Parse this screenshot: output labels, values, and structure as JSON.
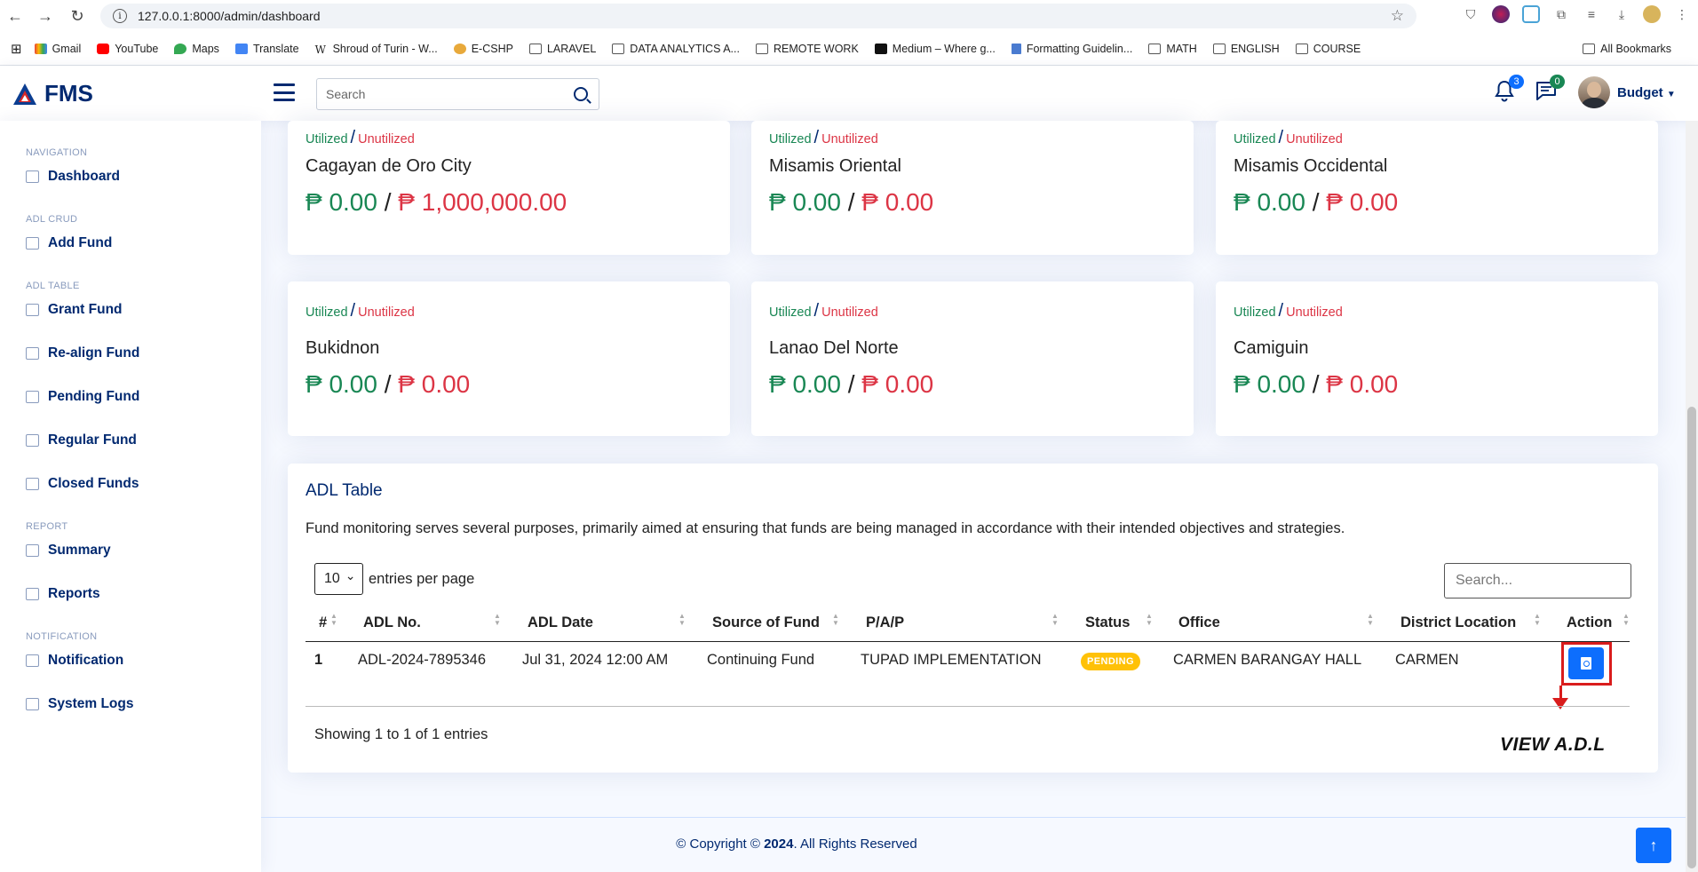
{
  "browser": {
    "url": "127.0.0.1:8000/admin/dashboard",
    "bookmarks": [
      {
        "label": "Gmail",
        "icon": "gmail-icon"
      },
      {
        "label": "YouTube",
        "icon": "youtube-icon"
      },
      {
        "label": "Maps",
        "icon": "maps-icon"
      },
      {
        "label": "Translate",
        "icon": "translate-icon"
      },
      {
        "label": "Shroud of Turin - W...",
        "icon": "wikipedia-icon"
      },
      {
        "label": "E-CSHP",
        "icon": "site-icon"
      },
      {
        "label": "LARAVEL",
        "icon": "folder-icon"
      },
      {
        "label": "DATA ANALYTICS A...",
        "icon": "folder-icon"
      },
      {
        "label": "REMOTE WORK",
        "icon": "folder-icon"
      },
      {
        "label": "Medium – Where g...",
        "icon": "medium-icon"
      },
      {
        "label": "Formatting Guidelin...",
        "icon": "doc-icon"
      },
      {
        "label": "MATH",
        "icon": "folder-icon"
      },
      {
        "label": "ENGLISH",
        "icon": "folder-icon"
      },
      {
        "label": "COURSE",
        "icon": "folder-icon"
      }
    ],
    "all_bookmarks": "All Bookmarks"
  },
  "header": {
    "logo": "FMS",
    "search_placeholder": "Search",
    "notifications_count": "3",
    "messages_count": "0",
    "user_name": "Budget"
  },
  "sidebar": {
    "sections": [
      {
        "heading": "NAVIGATION",
        "items": [
          {
            "label": "Dashboard",
            "icon": "grid-icon"
          }
        ]
      },
      {
        "heading": "ADL CRUD",
        "items": [
          {
            "label": "Add Fund",
            "icon": "card-icon"
          }
        ]
      },
      {
        "heading": "ADL TABLE",
        "items": [
          {
            "label": "Grant Fund",
            "icon": "calendar-icon"
          },
          {
            "label": "Re-align Fund",
            "icon": "document-icon"
          },
          {
            "label": "Pending Fund",
            "icon": "calendar-icon"
          },
          {
            "label": "Regular Fund",
            "icon": "id-card-icon"
          },
          {
            "label": "Closed Funds",
            "icon": "receipt-icon"
          }
        ]
      },
      {
        "heading": "REPORT",
        "items": [
          {
            "label": "Summary",
            "icon": "bar-chart-icon"
          },
          {
            "label": "Reports",
            "icon": "line-chart-icon"
          }
        ]
      },
      {
        "heading": "NOTIFICATION",
        "items": [
          {
            "label": "Notification",
            "icon": "bell-icon"
          },
          {
            "label": "System Logs",
            "icon": "gear-icon"
          }
        ]
      }
    ]
  },
  "regions": [
    {
      "name": "Cagayan de Oro City",
      "utilized": "₱ 0.00",
      "unutilized": "₱ 1,000,000.00"
    },
    {
      "name": "Misamis Oriental",
      "utilized": "₱ 0.00",
      "unutilized": "₱ 0.00"
    },
    {
      "name": "Misamis Occidental",
      "utilized": "₱ 0.00",
      "unutilized": "₱ 0.00"
    },
    {
      "name": "Bukidnon",
      "utilized": "₱ 0.00",
      "unutilized": "₱ 0.00"
    },
    {
      "name": "Lanao Del Norte",
      "utilized": "₱ 0.00",
      "unutilized": "₱ 0.00"
    },
    {
      "name": "Camiguin",
      "utilized": "₱ 0.00",
      "unutilized": "₱ 0.00"
    }
  ],
  "labels": {
    "utilized": "Utilized",
    "unutilized": "Unutilized",
    "separator": "/"
  },
  "adl_table": {
    "title": "ADL Table",
    "description": "Fund monitoring serves several purposes, primarily aimed at ensuring that funds are being managed in accordance with their intended objectives and strategies.",
    "page_size": "10",
    "entries_label": "entries per page",
    "search_placeholder": "Search...",
    "columns": [
      "#",
      "ADL No.",
      "ADL Date",
      "Source of Fund",
      "P/A/P",
      "Status",
      "Office",
      "District Location",
      "Action"
    ],
    "rows": [
      {
        "num": "1",
        "adl_no": "ADL-2024-7895346",
        "adl_date": "Jul 31, 2024 12:00 AM",
        "source": "Continuing Fund",
        "pap": "TUPAD IMPLEMENTATION",
        "status": "PENDING",
        "office": "CARMEN BARANGAY HALL",
        "district": "CARMEN"
      }
    ],
    "showing": "Showing 1 to 1 of 1 entries",
    "annotation": "VIEW A.D.L"
  },
  "footer": {
    "prefix": "© Copyright ©",
    "year": "2024",
    "suffix": ". All Rights Reserved"
  }
}
